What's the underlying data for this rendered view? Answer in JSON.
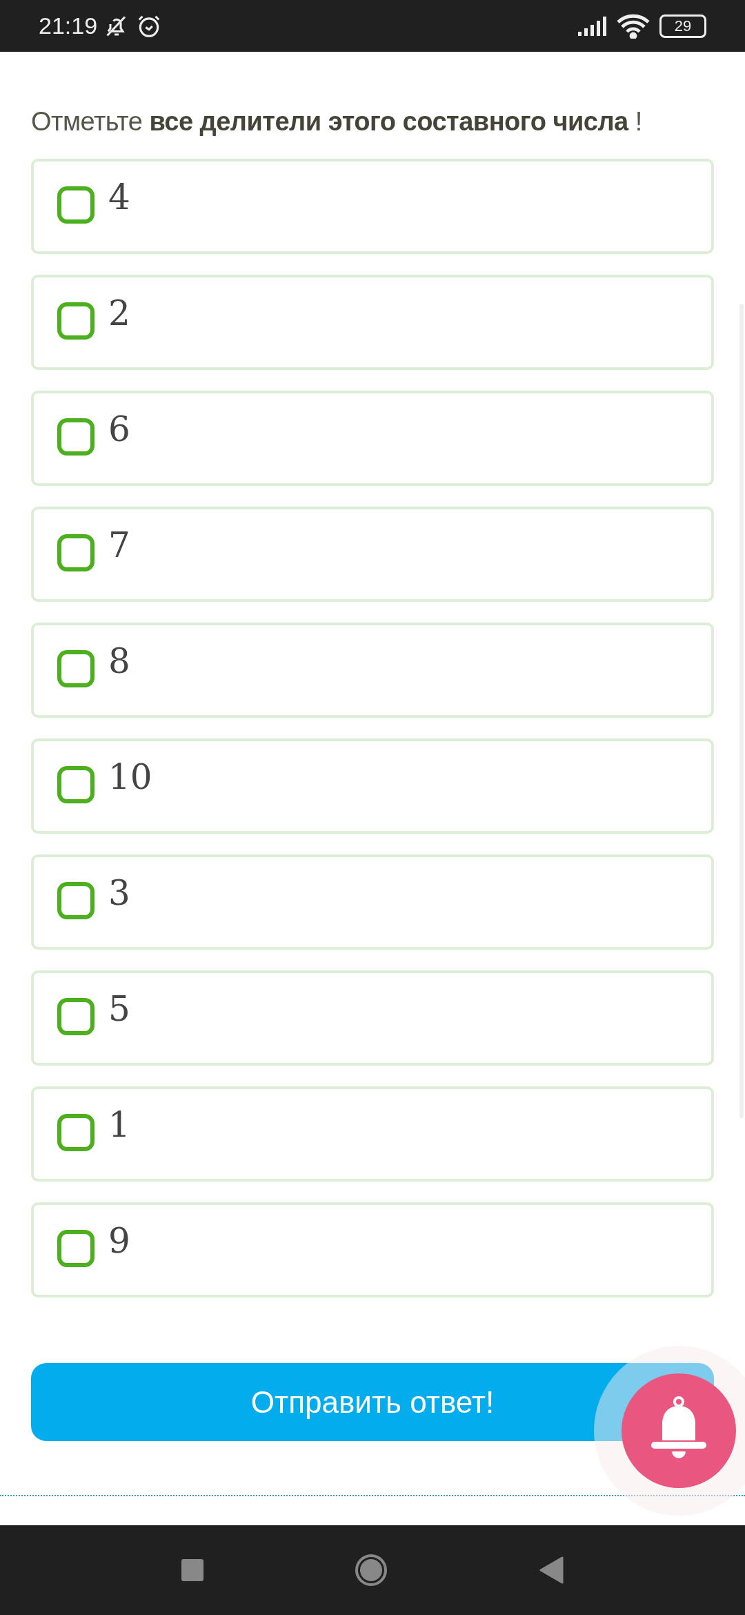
{
  "status_bar": {
    "time": "21:19",
    "battery": "29"
  },
  "question": "Отметьте **все делители этого составного числа** !",
  "options": [
    {
      "label": "4",
      "checked": false
    },
    {
      "label": "2",
      "checked": false
    },
    {
      "label": "6",
      "checked": false
    },
    {
      "label": "7",
      "checked": false
    },
    {
      "label": "8",
      "checked": false
    },
    {
      "label": "10",
      "checked": false
    },
    {
      "label": "3",
      "checked": false
    },
    {
      "label": "5",
      "checked": false
    },
    {
      "label": "1",
      "checked": false
    },
    {
      "label": "9",
      "checked": false
    }
  ],
  "submit_button": "Отправить ответ!"
}
